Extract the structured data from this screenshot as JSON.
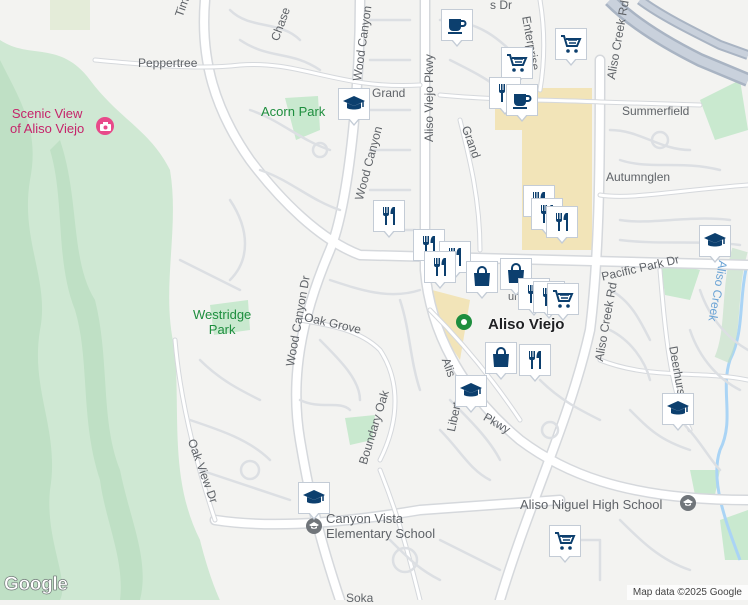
{
  "map": {
    "colors": {
      "background": "#f3f3f1",
      "park": "#c9e9cf",
      "hills": "#cfe8d3",
      "road": "#ffffff",
      "road_outline": "#d5d8dc",
      "freeway": "#a9b4c3",
      "commercial": "#f2e4b8",
      "water": "#aad4f5",
      "marker": "#0c3f6e",
      "poi_pink": "#e84a8a",
      "poi_green": "#1e8e3e",
      "poi_gray": "#70757a"
    }
  },
  "streets": {
    "timber": "Timb",
    "chase": "Chase",
    "wood_canyon_top": "Wood Canyon",
    "wood_canyon_mid": "Wood Canyon",
    "wood_canyon_dr": "Wood Canyon Dr",
    "peppertree": "Peppertree",
    "grand_left": "Grand",
    "grand_mid": "Grand",
    "aliso_viejo_pkwy": "Aliso Viejo Pkwy",
    "enterprise": "Enterprise",
    "dr_top": "s Dr",
    "aliso_creek_rd_top": "Aliso Creek Rd",
    "summerfield": "Summerfield",
    "autumnglen": "Autumnglen",
    "pacific_park": "Pacific Park Dr",
    "aliso_creek_rd": "Aliso Creek Rd",
    "oak_grove": "Oak Grove",
    "boundary_oak": "Boundary Oak",
    "oak_view": "Oak View Dr",
    "liberty": "Liberty",
    "pkwy": "Pkwy",
    "aliso_lower": "Alis",
    "deerhurst": "Deerhurs",
    "aliso_creek": "Aliso Creek",
    "soka": "Soka",
    "lower_dot": "umes"
  },
  "places": {
    "scenic_view": "Scenic View\nof Aliso Viejo",
    "acorn_park": "Acorn Park",
    "westridge_park": "Westridge\nPark",
    "aliso_niguel_high": "Aliso Niguel High School",
    "canyon_vista": "Canyon Vista\nElementary School",
    "city": "Aliso Viejo"
  },
  "markers": [
    {
      "type": "coffee",
      "icon": "coffee-icon"
    },
    {
      "type": "shopping-cart",
      "icon": "cart-icon"
    },
    {
      "type": "shopping-cart",
      "icon": "cart-icon"
    },
    {
      "type": "restaurant",
      "icon": "fork-knife-icon"
    },
    {
      "type": "coffee",
      "icon": "coffee-icon"
    },
    {
      "type": "school",
      "icon": "graduation-cap-icon"
    },
    {
      "type": "restaurant",
      "icon": "fork-knife-icon"
    },
    {
      "type": "restaurant",
      "icon": "fork-knife-icon"
    },
    {
      "type": "restaurant",
      "icon": "fork-knife-icon"
    },
    {
      "type": "restaurant",
      "icon": "fork-knife-icon"
    },
    {
      "type": "shopping-bag",
      "icon": "shopping-bag-icon"
    },
    {
      "type": "shopping-bag",
      "icon": "shopping-bag-icon"
    },
    {
      "type": "shopping-cart",
      "icon": "cart-icon"
    },
    {
      "type": "restaurant",
      "icon": "fork-knife-icon"
    },
    {
      "type": "shopping-bag",
      "icon": "shopping-bag-icon"
    },
    {
      "type": "restaurant",
      "icon": "fork-knife-icon"
    },
    {
      "type": "school",
      "icon": "graduation-cap-icon"
    },
    {
      "type": "school",
      "icon": "graduation-cap-icon"
    },
    {
      "type": "school",
      "icon": "graduation-cap-icon"
    },
    {
      "type": "shopping-cart",
      "icon": "cart-icon"
    },
    {
      "type": "school",
      "icon": "graduation-cap-icon"
    }
  ],
  "footer": {
    "logo": "Google",
    "attribution": "Map data ©2025 Google"
  }
}
